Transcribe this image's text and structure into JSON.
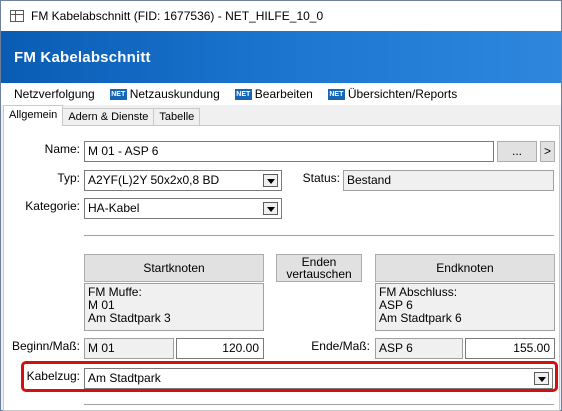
{
  "window": {
    "title": "FM Kabelabschnitt (FID: 1677536) - NET_HILFE_10_0",
    "banner_title": "FM Kabelabschnitt"
  },
  "menu": {
    "items": [
      {
        "label": "Netzverfolgung",
        "icon": ""
      },
      {
        "label": "Netzauskundung",
        "icon": "net-icon"
      },
      {
        "label": "Bearbeiten",
        "icon": "net-icon"
      },
      {
        "label": "Übersichten/Reports",
        "icon": "net-icon"
      }
    ],
    "icon_text": "NET"
  },
  "tabs": [
    {
      "label": "Allgemein",
      "active": true
    },
    {
      "label": "Adern & Dienste",
      "active": false
    },
    {
      "label": "Tabelle",
      "active": false
    }
  ],
  "form": {
    "name_label": "Name:",
    "name_value": "M 01 - ASP 6",
    "browse_label": "...",
    "next_label": ">",
    "typ_label": "Typ:",
    "typ_value": "A2YF(L)2Y 50x2x0,8 BD",
    "status_label": "Status:",
    "status_value": "Bestand",
    "kategorie_label": "Kategorie:",
    "kategorie_value": "HA-Kabel",
    "startknoten_button": "Startknoten",
    "enden_button_line1": "Enden",
    "enden_button_line2": "vertauschen",
    "endknoten_button": "Endknoten",
    "start_info": [
      "FM Muffe:",
      "M 01",
      "Am Stadtpark 3"
    ],
    "end_info": [
      "FM Abschluss:",
      "ASP 6",
      "Am Stadtpark 6"
    ],
    "beginn_label": "Beginn/Maß:",
    "beginn_node": "M 01",
    "beginn_mass": "120.00",
    "ende_label": "Ende/Maß:",
    "ende_node": "ASP 6",
    "ende_mass": "155.00",
    "kabelzug_label": "Kabelzug:",
    "kabelzug_value": "Am Stadtpark"
  },
  "colors": {
    "banner": "#1566b7",
    "highlight": "#d21010"
  }
}
